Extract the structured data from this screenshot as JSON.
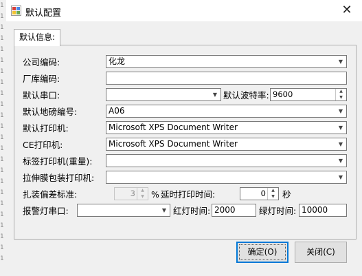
{
  "gutter": {
    "lines": [
      "1",
      "1",
      "1",
      "1",
      "1",
      "1",
      "1",
      "1",
      "1",
      "1",
      "1",
      "1",
      "1",
      "1",
      "1",
      "1",
      "1",
      "1",
      "1",
      "1",
      "1",
      "1",
      "1",
      "1"
    ]
  },
  "window": {
    "title": "默认配置",
    "close_glyph": "✕"
  },
  "tab": {
    "label": "默认信息:"
  },
  "form": {
    "company_code": {
      "label": "公司编码:",
      "value": "化龙"
    },
    "warehouse_code": {
      "label": "厂库编码:",
      "value": ""
    },
    "serial_port": {
      "label": "默认串口:",
      "value": ""
    },
    "baud_rate": {
      "label": "默认波特率:",
      "value": "9600"
    },
    "scale_no": {
      "label": "默认地磅编号:",
      "value": "A06"
    },
    "printer": {
      "label": "默认打印机:",
      "value": "Microsoft XPS Document Writer"
    },
    "ce_printer": {
      "label": "CE打印机:",
      "value": "Microsoft XPS Document Writer"
    },
    "label_printer": {
      "label": "标签打印机(重量):",
      "value": ""
    },
    "stretch_printer": {
      "label": "拉伸膜包装打印机:",
      "value": ""
    },
    "tolerance": {
      "label": "扎装偏差标准:",
      "value": "3",
      "unit": "%"
    },
    "print_delay": {
      "label": "延时打印时间:",
      "value": "0",
      "unit": "秒"
    },
    "alarm_port": {
      "label": "报警灯串口:",
      "value": ""
    },
    "red_light": {
      "label": "红灯时间:",
      "value": "2000"
    },
    "green_light": {
      "label": "绿灯时间:",
      "value": "10000"
    }
  },
  "buttons": {
    "ok": "确定(O)",
    "cancel": "关闭(C)"
  },
  "icons": {
    "app": "app-icon",
    "close": "close-icon",
    "dropdown": "chevron-down-icon",
    "spin_up": "spin-up-icon",
    "spin_down": "spin-down-icon"
  },
  "colors": {
    "focus_border": "#0078d7",
    "window_bg": "#f0f0f0"
  }
}
